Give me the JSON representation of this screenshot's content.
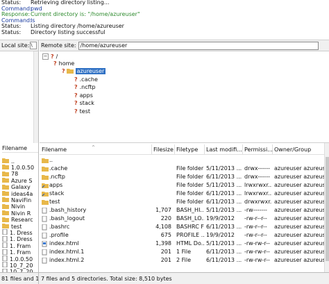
{
  "log": [
    {
      "key": "Status:",
      "value": "Retrieving directory listing...",
      "color": "black"
    },
    {
      "key": "Command:",
      "value": "pwd",
      "color": "blue"
    },
    {
      "key": "Response:",
      "value": "Current directory is: \"/home/azureuser\"",
      "color": "green"
    },
    {
      "key": "Command:",
      "value": "ls",
      "color": "blue"
    },
    {
      "key": "Status:",
      "value": "Listing directory /home/azureuser",
      "color": "black"
    },
    {
      "key": "Status:",
      "value": "Directory listing successful",
      "color": "black"
    }
  ],
  "local": {
    "label": "Local site:",
    "path_value": "\\",
    "header": "Filename",
    "items": [
      "..",
      "1.0.0.50",
      "78",
      "Azure S",
      "Galaxy",
      "ideas4a",
      "NaviFin",
      "Nivin",
      "Nivin R",
      "Researc",
      "test",
      "1. Dress",
      "1. Dress",
      "1. Fram",
      "1. Fram",
      "1.0.0.50",
      "10_7_20",
      "10_7_20"
    ]
  },
  "remote": {
    "label": "Remote site:",
    "path_value": "/home/azureuser",
    "tree": {
      "root": "/",
      "home": "home",
      "selected": "azureuser",
      "children": [
        ".cache",
        ".ncftp",
        "apps",
        "stack",
        "test"
      ]
    },
    "columns": {
      "filename": "Filename",
      "filesize": "Filesize",
      "filetype": "Filetype",
      "modified": "Last modifi...",
      "perms": "Permissi...",
      "owner": "Owner/Group"
    },
    "files": [
      {
        "name": "..",
        "size": "",
        "type": "",
        "mod": "",
        "perm": "",
        "owner": "",
        "icon": "folder"
      },
      {
        "name": ".cache",
        "size": "",
        "type": "File folder",
        "mod": "5/11/2013 ...",
        "perm": "drwx------",
        "owner": "azureuser azureuser",
        "icon": "folder"
      },
      {
        "name": ".ncftp",
        "size": "",
        "type": "File folder",
        "mod": "6/11/2013 ...",
        "perm": "drwx------",
        "owner": "azureuser azureuser",
        "icon": "folder"
      },
      {
        "name": "apps",
        "size": "",
        "type": "File folder",
        "mod": "5/11/2013 ...",
        "perm": "lrwxrwxr...",
        "owner": "azureuser azureuser",
        "icon": "link"
      },
      {
        "name": "stack",
        "size": "",
        "type": "File folder",
        "mod": "6/11/2013 ...",
        "perm": "lrwxrwxr...",
        "owner": "azureuser azureuser",
        "icon": "link"
      },
      {
        "name": "test",
        "size": "",
        "type": "File folder",
        "mod": "6/11/2013 ...",
        "perm": "drwxrwxr...",
        "owner": "azureuser azureuser",
        "icon": "folder"
      },
      {
        "name": ".bash_history",
        "size": "1,707",
        "type": "BASH_HI...",
        "mod": "5/11/2013 ...",
        "perm": "-rw-------",
        "owner": "azureuser azureuser",
        "icon": "file"
      },
      {
        "name": ".bash_logout",
        "size": "220",
        "type": "BASH_LO...",
        "mod": "19/9/2012",
        "perm": "-rw-r--r--",
        "owner": "azureuser azureuser",
        "icon": "file"
      },
      {
        "name": ".bashrc",
        "size": "4,108",
        "type": "BASHRC File",
        "mod": "6/11/2013 ...",
        "perm": "-rw-r--r--",
        "owner": "azureuser azureuser",
        "icon": "file"
      },
      {
        "name": ".profile",
        "size": "675",
        "type": "PROFILE ...",
        "mod": "19/9/2012",
        "perm": "-rw-r--r--",
        "owner": "azureuser azureuser",
        "icon": "file"
      },
      {
        "name": "index.html",
        "size": "1,398",
        "type": "HTML Do...",
        "mod": "5/11/2013 ...",
        "perm": "-rw-rw-r--",
        "owner": "azureuser azureuser",
        "icon": "html"
      },
      {
        "name": "index.html.1",
        "size": "201",
        "type": "1 File",
        "mod": "6/11/2013 ...",
        "perm": "-rw-rw-r--",
        "owner": "azureuser azureuser",
        "icon": "file"
      },
      {
        "name": "index.html.2",
        "size": "201",
        "type": "2 File",
        "mod": "6/11/2013 ...",
        "perm": "-rw-rw-r--",
        "owner": "azureuser azureuser",
        "icon": "file"
      }
    ]
  },
  "status": {
    "local": "81 files and 10",
    "remote": "7 files and 5 directories. Total size: 8,510 bytes"
  },
  "colors": {
    "selection": "#3071c4",
    "folder": "#e8b84a",
    "green": "#2e8b2e",
    "blue": "#1a3ca0"
  }
}
